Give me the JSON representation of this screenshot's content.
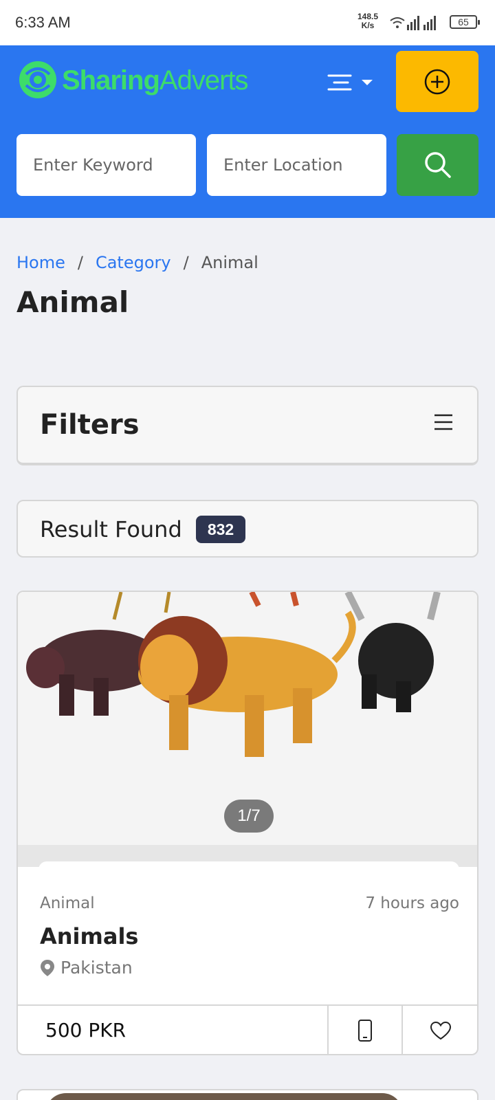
{
  "status_bar": {
    "time": "6:33 AM",
    "speed_value": "148.5",
    "speed_unit": "K/s",
    "battery": "65"
  },
  "header": {
    "logo_part1": "Sharing",
    "logo_part2": "Adverts",
    "keyword_placeholder": "Enter Keyword",
    "location_placeholder": "Enter Location",
    "accent_color": "#2a76f0",
    "post_button_color": "#fcb900",
    "search_button_color": "#37a145"
  },
  "breadcrumb": {
    "home": "Home",
    "category": "Category",
    "current": "Animal",
    "separator": "/"
  },
  "page_title": "Animal",
  "filters": {
    "label": "Filters"
  },
  "results": {
    "label": "Result Found",
    "count": "832"
  },
  "listing": {
    "image_counter": "1/7",
    "category": "Animal",
    "posted": "7 hours ago",
    "title": "Animals",
    "location": "Pakistan",
    "price": "500 PKR",
    "icons": [
      "phone-icon",
      "heart-icon"
    ]
  }
}
